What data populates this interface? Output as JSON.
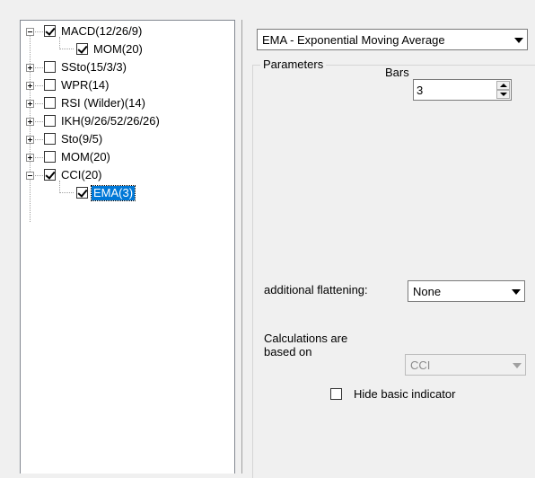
{
  "tree": {
    "items": [
      {
        "label": "MACD(12/26/9)",
        "checked": true,
        "expander": "minus"
      },
      {
        "label": "MOM(20)",
        "checked": true,
        "child": true
      },
      {
        "label": "SSto(15/3/3)",
        "checked": false,
        "expander": "plus"
      },
      {
        "label": "WPR(14)",
        "checked": false,
        "expander": "plus"
      },
      {
        "label": "RSI (Wilder)(14)",
        "checked": false,
        "expander": "plus"
      },
      {
        "label": "IKH(9/26/52/26/26)",
        "checked": false,
        "expander": "plus"
      },
      {
        "label": "Sto(9/5)",
        "checked": false,
        "expander": "plus"
      },
      {
        "label": "MOM(20)",
        "checked": false,
        "expander": "plus"
      },
      {
        "label": "CCI(20)",
        "checked": true,
        "expander": "minus"
      },
      {
        "label": "EMA(3)",
        "checked": true,
        "child": true,
        "selected": true
      }
    ]
  },
  "settings": {
    "indicator_type": "EMA - Exponential Moving Average",
    "parameters_legend": "Parameters",
    "bars_label": "Bars",
    "bars_value": "3",
    "flattening_label": "additional flattening:",
    "flattening_value": "None",
    "calc_label_line1": "Calculations are",
    "calc_label_line2": "based on",
    "calc_value": "CCI",
    "hide_basic_label": "Hide basic indicator",
    "hide_basic_checked": false
  },
  "colors": {
    "selection": "#0078d7",
    "panel_bg": "#f0f0f0"
  }
}
